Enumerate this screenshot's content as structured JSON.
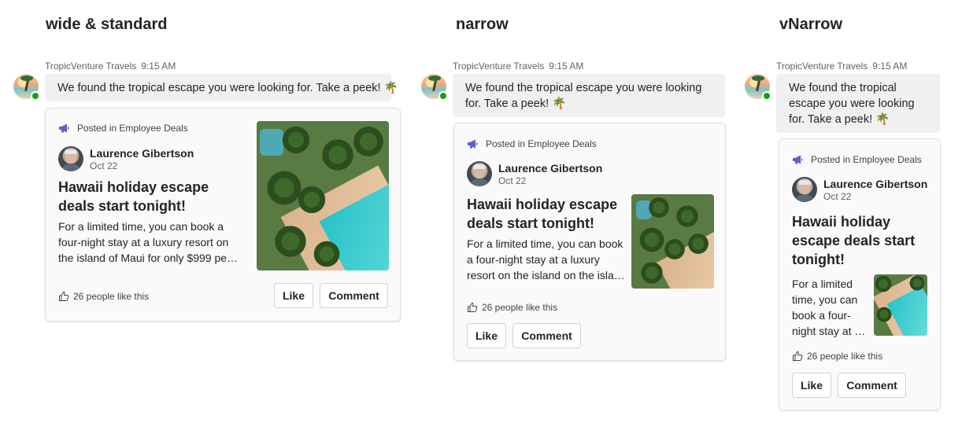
{
  "variants": [
    {
      "heading": "wide & standard",
      "sender": "TropicVenture Travels",
      "time": "9:15 AM",
      "message": "We found the tropical escape you were looking for. Take a peek! 🌴",
      "posted": "Posted in Employee Deals",
      "author_name": "Laurence Gibertson",
      "author_date": "Oct 22",
      "title": "Hawaii holiday escape deals start tonight!",
      "body": "For a limited time, you can book a four-night stay at a luxury resort on the island of Maui for only $999 pe…",
      "likes": "26 people like this",
      "like_label": "Like",
      "comment_label": "Comment"
    },
    {
      "heading": "narrow",
      "sender": "TropicVenture Travels",
      "time": "9:15 AM",
      "message": "We found the tropical escape you were looking for. Take a peek! 🌴",
      "posted": "Posted in Employee Deals",
      "author_name": "Laurence Gibertson",
      "author_date": "Oct 22",
      "title": "Hawaii holiday escape deals start tonight!",
      "body": "For a limited time, you can book a four-night stay at a luxury resort on the island on the isla…",
      "likes": "26 people like this",
      "like_label": "Like",
      "comment_label": "Comment"
    },
    {
      "heading": "vNarrow",
      "sender": "TropicVenture Travels",
      "time": "9:15 AM",
      "message": "We found the tropical escape you were looking for. Take a peek! 🌴",
      "posted": "Posted in Employee Deals",
      "author_name": "Laurence Gibertson",
      "author_date": "Oct 22",
      "title": "Hawaii holiday escape deals start tonight!",
      "body": "For a limited time, you can book a four-night stay at …",
      "likes": "26 people like this",
      "like_label": "Like",
      "comment_label": "Comment"
    }
  ],
  "colors": {
    "accent_icon": "#5b5fc7",
    "status_available": "#13a10e",
    "bubble_bg": "#f0f0f0",
    "card_bg": "#fafafa"
  },
  "icons": {
    "bot_avatar": "tropical-beach-avatar",
    "posted": "megaphone-icon",
    "likes": "thumbs-up-icon"
  }
}
